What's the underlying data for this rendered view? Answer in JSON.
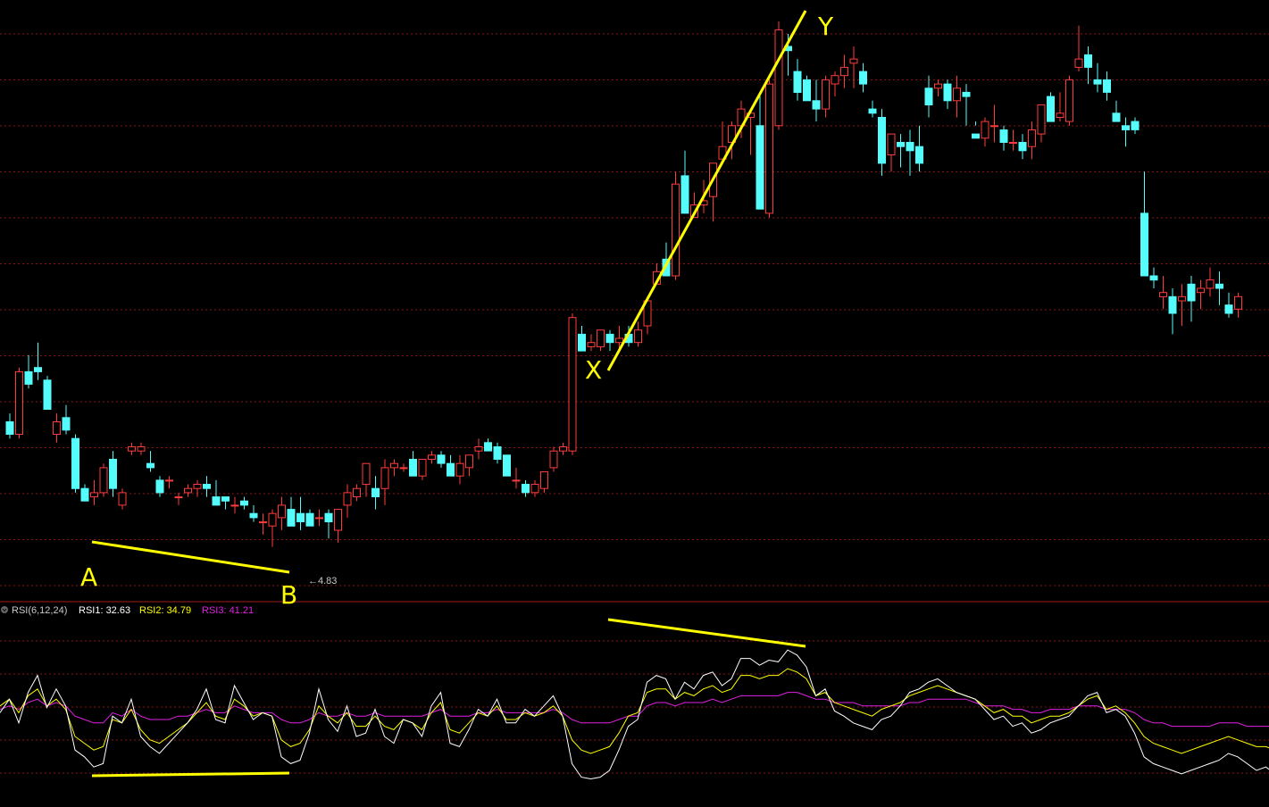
{
  "colors": {
    "background": "#000000",
    "up": "#ff3c3c",
    "down": "#54fcfc",
    "grid": "#8a1414",
    "divider": "#a01c1c",
    "annotation": "#ffff00",
    "rsi1": "#ffffff",
    "rsi2": "#ffff00",
    "rsi3": "#e020e0",
    "label_gray": "#c8c8c8"
  },
  "rsi_header": {
    "icon": "circle-chevron-down-icon",
    "name": "RSI(6,12,24)",
    "rsi1": "RSI1: 32.63",
    "rsi2": "RSI2: 34.79",
    "rsi3": "RSI3: 41.21"
  },
  "annotations": {
    "label_a": "A",
    "label_b": "B",
    "label_x": "X",
    "label_y": "Y",
    "low_marker": "←4.83"
  },
  "chart_data": [
    {
      "type": "candlestick",
      "panel": "price",
      "low_marker_value": 4.83,
      "ylim": [
        4.72,
        6.12
      ],
      "grid": true,
      "candles": [
        [
          5.13,
          5.15,
          5.09,
          5.1
        ],
        [
          5.1,
          5.26,
          5.09,
          5.25
        ],
        [
          5.25,
          5.29,
          5.21,
          5.22
        ],
        [
          5.26,
          5.32,
          5.23,
          5.25
        ],
        [
          5.23,
          5.24,
          5.16,
          5.16
        ],
        [
          5.1,
          5.15,
          5.08,
          5.13
        ],
        [
          5.14,
          5.17,
          5.1,
          5.11
        ],
        [
          5.09,
          5.1,
          4.96,
          4.97
        ],
        [
          4.97,
          4.98,
          4.94,
          4.94
        ],
        [
          4.95,
          4.99,
          4.93,
          4.96
        ],
        [
          4.96,
          5.03,
          4.95,
          5.02
        ],
        [
          5.04,
          5.06,
          4.95,
          4.97
        ],
        [
          4.93,
          4.97,
          4.92,
          4.96
        ],
        [
          5.06,
          5.08,
          5.05,
          5.07
        ],
        [
          5.06,
          5.08,
          5.05,
          5.07
        ],
        [
          5.03,
          5.06,
          5.01,
          5.02
        ],
        [
          4.99,
          5.0,
          4.95,
          4.96
        ],
        [
          4.99,
          5.0,
          4.97,
          4.99
        ],
        [
          4.95,
          4.96,
          4.93,
          4.95
        ],
        [
          4.96,
          4.98,
          4.95,
          4.97
        ],
        [
          4.97,
          4.99,
          4.95,
          4.98
        ],
        [
          4.98,
          5.0,
          4.95,
          4.97
        ],
        [
          4.95,
          4.99,
          4.93,
          4.93
        ],
        [
          4.95,
          4.95,
          4.92,
          4.94
        ],
        [
          4.93,
          4.95,
          4.91,
          4.93
        ],
        [
          4.94,
          4.95,
          4.92,
          4.93
        ],
        [
          4.91,
          4.93,
          4.89,
          4.9
        ],
        [
          4.89,
          4.91,
          4.86,
          4.89
        ],
        [
          4.88,
          4.92,
          4.83,
          4.91
        ],
        [
          4.9,
          4.95,
          4.87,
          4.93
        ],
        [
          4.92,
          4.95,
          4.89,
          4.88
        ],
        [
          4.91,
          4.95,
          4.87,
          4.89
        ],
        [
          4.91,
          4.92,
          4.88,
          4.88
        ],
        [
          4.9,
          4.92,
          4.88,
          4.9
        ],
        [
          4.91,
          4.92,
          4.85,
          4.89
        ],
        [
          4.87,
          4.91,
          4.84,
          4.92
        ],
        [
          4.93,
          4.98,
          4.9,
          4.96
        ],
        [
          4.95,
          4.98,
          4.94,
          4.97
        ],
        [
          4.98,
          5.01,
          4.95,
          5.03
        ],
        [
          4.97,
          5.0,
          4.92,
          4.95
        ],
        [
          4.97,
          5.04,
          4.93,
          5.02
        ],
        [
          5.02,
          5.04,
          5.0,
          5.03
        ],
        [
          5.02,
          5.03,
          5.01,
          5.02
        ],
        [
          5.04,
          5.06,
          5.01,
          5.0
        ],
        [
          5.0,
          5.04,
          4.99,
          5.04
        ],
        [
          5.04,
          5.06,
          5.03,
          5.05
        ],
        [
          5.05,
          5.06,
          5.02,
          5.03
        ],
        [
          5.03,
          5.05,
          5.01,
          5.0
        ],
        [
          5.0,
          5.05,
          4.98,
          5.03
        ],
        [
          5.02,
          5.05,
          5.0,
          5.05
        ],
        [
          5.06,
          5.09,
          5.04,
          5.07
        ],
        [
          5.08,
          5.09,
          5.06,
          5.06
        ],
        [
          5.07,
          5.08,
          5.03,
          5.04
        ],
        [
          5.05,
          5.05,
          5.0,
          5.0
        ],
        [
          4.99,
          5.02,
          4.97,
          4.99
        ],
        [
          4.98,
          4.99,
          4.95,
          4.96
        ],
        [
          4.96,
          4.99,
          4.95,
          4.98
        ],
        [
          4.97,
          5.01,
          4.96,
          5.01
        ],
        [
          5.02,
          5.07,
          5.01,
          5.06
        ],
        [
          5.06,
          5.08,
          5.05,
          5.07
        ],
        [
          5.06,
          5.39,
          5.05,
          5.38
        ],
        [
          5.34,
          5.36,
          5.31,
          5.3
        ],
        [
          5.31,
          5.34,
          5.3,
          5.32
        ],
        [
          5.31,
          5.35,
          5.3,
          5.35
        ],
        [
          5.34,
          5.35,
          5.3,
          5.32
        ],
        [
          5.32,
          5.36,
          5.3,
          5.33
        ],
        [
          5.34,
          5.36,
          5.31,
          5.32
        ],
        [
          5.32,
          5.37,
          5.31,
          5.35
        ],
        [
          5.36,
          5.42,
          5.34,
          5.42
        ],
        [
          5.46,
          5.51,
          5.46,
          5.49
        ],
        [
          5.52,
          5.56,
          5.51,
          5.48
        ],
        [
          5.48,
          5.73,
          5.47,
          5.7
        ],
        [
          5.72,
          5.78,
          5.67,
          5.63
        ],
        [
          5.62,
          5.68,
          5.62,
          5.65
        ],
        [
          5.65,
          5.71,
          5.63,
          5.66
        ],
        [
          5.67,
          5.71,
          5.61,
          5.75
        ],
        [
          5.76,
          5.85,
          5.76,
          5.79
        ],
        [
          5.8,
          5.85,
          5.76,
          5.84
        ],
        [
          5.84,
          5.9,
          5.81,
          5.88
        ],
        [
          5.86,
          5.87,
          5.77,
          5.87
        ],
        [
          5.84,
          5.92,
          5.77,
          5.64
        ],
        [
          5.63,
          5.95,
          5.62,
          5.94
        ],
        [
          5.84,
          6.09,
          5.83,
          6.07
        ],
        [
          6.03,
          6.06,
          5.96,
          6.02
        ],
        [
          5.97,
          6.0,
          5.9,
          5.92
        ],
        [
          5.95,
          5.96,
          5.91,
          5.9
        ],
        [
          5.9,
          5.95,
          5.85,
          5.88
        ],
        [
          5.88,
          5.96,
          5.86,
          5.95
        ],
        [
          5.94,
          5.97,
          5.91,
          5.96
        ],
        [
          5.96,
          6.01,
          5.93,
          5.98
        ],
        [
          5.99,
          6.03,
          5.93,
          6.0
        ],
        [
          5.97,
          5.99,
          5.92,
          5.94
        ],
        [
          5.88,
          5.9,
          5.86,
          5.87
        ],
        [
          5.86,
          5.88,
          5.72,
          5.75
        ],
        [
          5.77,
          5.82,
          5.73,
          5.82
        ],
        [
          5.8,
          5.82,
          5.74,
          5.79
        ],
        [
          5.8,
          5.83,
          5.72,
          5.78
        ],
        [
          5.79,
          5.84,
          5.73,
          5.75
        ],
        [
          5.93,
          5.96,
          5.86,
          5.89
        ],
        [
          5.93,
          5.95,
          5.91,
          5.94
        ],
        [
          5.94,
          5.95,
          5.88,
          5.9
        ],
        [
          5.9,
          5.96,
          5.86,
          5.93
        ],
        [
          5.92,
          5.94,
          5.84,
          5.91
        ],
        [
          5.82,
          5.85,
          5.84,
          5.81
        ],
        [
          5.81,
          5.86,
          5.79,
          5.85
        ],
        [
          5.84,
          5.89,
          5.8,
          5.84
        ],
        [
          5.83,
          5.84,
          5.78,
          5.8
        ],
        [
          5.8,
          5.83,
          5.78,
          5.8
        ],
        [
          5.8,
          5.82,
          5.76,
          5.78
        ],
        [
          5.79,
          5.85,
          5.76,
          5.83
        ],
        [
          5.82,
          5.89,
          5.8,
          5.89
        ],
        [
          5.91,
          5.92,
          5.86,
          5.85
        ],
        [
          5.86,
          5.92,
          5.85,
          5.87
        ],
        [
          5.85,
          5.96,
          5.84,
          5.95
        ],
        [
          5.98,
          6.08,
          5.97,
          6.0
        ],
        [
          6.01,
          6.03,
          5.94,
          5.98
        ],
        [
          5.95,
          5.99,
          5.92,
          5.94
        ],
        [
          5.95,
          5.97,
          5.9,
          5.92
        ],
        [
          5.87,
          5.9,
          5.85,
          5.85
        ],
        [
          5.84,
          5.86,
          5.79,
          5.83
        ],
        [
          5.85,
          5.86,
          5.82,
          5.83
        ],
        [
          5.63,
          5.73,
          5.63,
          5.48
        ],
        [
          5.48,
          5.5,
          5.45,
          5.47
        ],
        [
          5.43,
          5.48,
          5.4,
          5.44
        ],
        [
          5.43,
          5.45,
          5.34,
          5.39
        ],
        [
          5.42,
          5.46,
          5.36,
          5.43
        ],
        [
          5.46,
          5.48,
          5.37,
          5.42
        ],
        [
          5.44,
          5.47,
          5.4,
          5.45
        ],
        [
          5.45,
          5.5,
          5.43,
          5.47
        ],
        [
          5.46,
          5.49,
          5.41,
          5.45
        ],
        [
          5.41,
          5.44,
          5.38,
          5.39
        ],
        [
          5.4,
          5.44,
          5.38,
          5.43
        ]
      ]
    },
    {
      "type": "line",
      "panel": "RSI(6,12,24)",
      "ylim": [
        0,
        100
      ],
      "series": [
        {
          "name": "RSI1",
          "values": [
            44,
            52,
            38,
            56,
            66,
            47,
            58,
            48,
            22,
            18,
            12,
            14,
            42,
            38,
            52,
            30,
            24,
            20,
            26,
            32,
            38,
            46,
            58,
            40,
            38,
            60,
            50,
            40,
            44,
            42,
            18,
            14,
            16,
            32,
            58,
            40,
            33,
            48,
            30,
            32,
            46,
            30,
            26,
            40,
            38,
            30,
            48,
            56,
            26,
            24,
            34,
            46,
            42,
            52,
            38,
            38,
            46,
            42,
            48,
            54,
            42,
            14,
            6,
            5,
            6,
            10,
            22,
            36,
            40,
            62,
            66,
            64,
            52,
            62,
            58,
            66,
            68,
            60,
            64,
            76,
            76,
            72,
            75,
            74,
            81,
            78,
            71,
            54,
            58,
            45,
            42,
            38,
            36,
            34,
            40,
            42,
            48,
            56,
            58,
            62,
            64,
            60,
            56,
            54,
            52,
            46,
            40,
            42,
            36,
            38,
            32,
            34,
            38,
            40,
            42,
            48,
            54,
            56,
            44,
            46,
            42,
            32,
            18,
            14,
            12,
            10,
            8,
            10,
            12,
            14,
            16,
            20,
            18,
            14,
            10,
            12,
            8
          ]
        },
        {
          "name": "RSI2",
          "values": [
            48,
            52,
            44,
            54,
            58,
            48,
            52,
            46,
            30,
            26,
            22,
            24,
            40,
            38,
            46,
            34,
            28,
            26,
            30,
            34,
            38,
            44,
            50,
            42,
            40,
            52,
            48,
            42,
            44,
            42,
            28,
            24,
            26,
            34,
            48,
            42,
            38,
            44,
            36,
            36,
            42,
            36,
            34,
            40,
            38,
            34,
            44,
            50,
            34,
            32,
            38,
            44,
            42,
            48,
            40,
            40,
            44,
            42,
            44,
            48,
            42,
            28,
            22,
            20,
            22,
            24,
            32,
            42,
            44,
            56,
            58,
            58,
            52,
            56,
            54,
            58,
            60,
            56,
            58,
            66,
            66,
            64,
            66,
            66,
            70,
            68,
            64,
            54,
            56,
            50,
            48,
            46,
            44,
            42,
            46,
            48,
            50,
            54,
            56,
            58,
            60,
            58,
            56,
            54,
            52,
            48,
            44,
            46,
            42,
            42,
            38,
            40,
            42,
            42,
            44,
            48,
            52,
            54,
            46,
            48,
            44,
            38,
            30,
            26,
            24,
            22,
            20,
            22,
            24,
            26,
            28,
            30,
            28,
            26,
            24,
            24,
            22
          ]
        },
        {
          "name": "RSI3",
          "values": [
            46,
            48,
            46,
            50,
            52,
            48,
            50,
            48,
            42,
            40,
            38,
            38,
            44,
            42,
            46,
            42,
            40,
            40,
            40,
            42,
            42,
            44,
            46,
            44,
            44,
            48,
            46,
            44,
            44,
            44,
            40,
            38,
            38,
            40,
            44,
            42,
            42,
            44,
            42,
            42,
            44,
            42,
            42,
            42,
            42,
            42,
            44,
            46,
            42,
            42,
            42,
            44,
            44,
            46,
            44,
            44,
            44,
            44,
            44,
            46,
            44,
            40,
            38,
            38,
            38,
            38,
            40,
            42,
            42,
            48,
            50,
            50,
            48,
            50,
            50,
            50,
            52,
            50,
            52,
            54,
            54,
            54,
            54,
            54,
            56,
            56,
            54,
            52,
            52,
            50,
            50,
            50,
            48,
            48,
            48,
            48,
            48,
            50,
            50,
            52,
            52,
            52,
            52,
            52,
            50,
            48,
            48,
            48,
            46,
            46,
            44,
            44,
            46,
            46,
            46,
            48,
            48,
            48,
            46,
            46,
            46,
            44,
            40,
            38,
            38,
            36,
            36,
            36,
            36,
            36,
            38,
            38,
            38,
            36,
            36,
            36,
            36
          ]
        }
      ]
    }
  ]
}
